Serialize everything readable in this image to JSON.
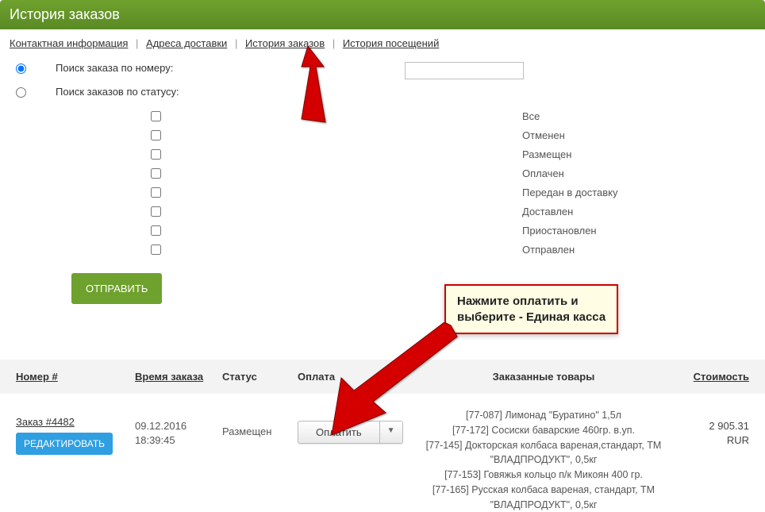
{
  "header": {
    "title": "История заказов"
  },
  "nav": {
    "contact": "Контактная информация",
    "addresses": "Адреса доставки",
    "orders": "История заказов",
    "visits": "История посещений"
  },
  "search": {
    "by_number_label": "Поиск заказа по номеру:",
    "by_status_label": "Поиск заказов по статусу:",
    "input_value": "",
    "statuses": [
      "Все",
      "Отменен",
      "Размещен",
      "Оплачен",
      "Передан в доставку",
      "Доставлен",
      "Приостановлен",
      "Отправлен"
    ],
    "submit_label": "ОТПРАВИТЬ"
  },
  "hint": {
    "line1": "Нажмите оплатить и",
    "line2": "выберите - Единая касса"
  },
  "table": {
    "headers": {
      "number": "Номер #",
      "time": "Время заказа",
      "status": "Статус",
      "payment": "Оплата",
      "items": "Заказанные товары",
      "cost": "Стоимость"
    },
    "row": {
      "order_link": "Заказ #4482",
      "edit_label": "РЕДАКТИРОВАТЬ",
      "date": "09.12.2016",
      "time": "18:39:45",
      "status": "Размещен",
      "pay_label": "Оплатить",
      "items": [
        "[77-087] Лимонад \"Буратино\" 1,5л",
        "[77-172] Сосиски баварские 460гр. в.уп.",
        "[77-145] Докторская колбаса вареная,стандарт, ТМ \"ВЛАДПРОДУКТ\", 0,5кг",
        "[77-153] Говяжья кольцо п/к Микоян 400 гр.",
        "[77-165] Русская колбаса вареная, стандарт, ТМ \"ВЛАДПРОДУКТ\", 0,5кг"
      ],
      "cost_value": "2 905.31",
      "cost_currency": "RUR"
    }
  }
}
